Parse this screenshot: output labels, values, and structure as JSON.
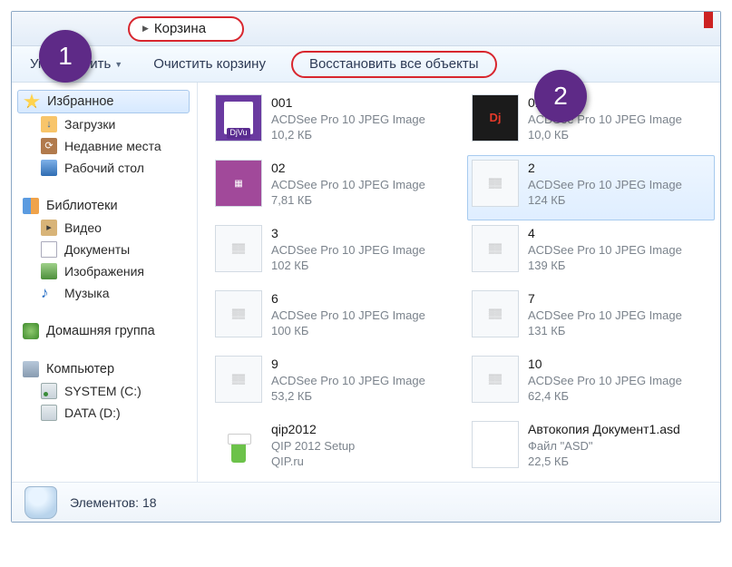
{
  "header": {
    "breadcrumb": "Корзина"
  },
  "callouts": {
    "one": "1",
    "two": "2"
  },
  "toolbar": {
    "organize": "Упорядочить",
    "empty": "Очистить корзину",
    "restore": "Восстановить все объекты"
  },
  "sidebar": {
    "fav_header": "Избранное",
    "fav_items": [
      {
        "label": "Загрузки"
      },
      {
        "label": "Недавние места"
      },
      {
        "label": "Рабочий стол"
      }
    ],
    "lib_header": "Библиотеки",
    "lib_items": [
      {
        "label": "Видео"
      },
      {
        "label": "Документы"
      },
      {
        "label": "Изображения"
      },
      {
        "label": "Музыка"
      }
    ],
    "homegroup": "Домашняя группа",
    "computer": "Компьютер",
    "drives": [
      {
        "label": "SYSTEM (C:)"
      },
      {
        "label": "DATA (D:)"
      }
    ]
  },
  "files": [
    {
      "name": "001",
      "type": "ACDSee Pro 10 JPEG Image",
      "size": "10,2 КБ",
      "thumb": "djvu"
    },
    {
      "name": "01",
      "type": "ACDSee Pro 10 JPEG Image",
      "size": "10,0 КБ",
      "thumb": "dj2"
    },
    {
      "name": "02",
      "type": "ACDSee Pro 10 JPEG Image",
      "size": "7,81 КБ",
      "thumb": "purple"
    },
    {
      "name": "2",
      "type": "ACDSee Pro 10 JPEG Image",
      "size": "124 КБ",
      "thumb": "img",
      "selected": true
    },
    {
      "name": "3",
      "type": "ACDSee Pro 10 JPEG Image",
      "size": "102 КБ",
      "thumb": "img"
    },
    {
      "name": "4",
      "type": "ACDSee Pro 10 JPEG Image",
      "size": "139 КБ",
      "thumb": "img"
    },
    {
      "name": "6",
      "type": "ACDSee Pro 10 JPEG Image",
      "size": "100 КБ",
      "thumb": "img"
    },
    {
      "name": "7",
      "type": "ACDSee Pro 10 JPEG Image",
      "size": "131 КБ",
      "thumb": "img"
    },
    {
      "name": "9",
      "type": "ACDSee Pro 10 JPEG Image",
      "size": "53,2 КБ",
      "thumb": "img"
    },
    {
      "name": "10",
      "type": "ACDSee Pro 10 JPEG Image",
      "size": "62,4 КБ",
      "thumb": "img"
    },
    {
      "name": "qip2012",
      "type": "QIP 2012 Setup",
      "size": "QIP.ru",
      "thumb": "qip"
    },
    {
      "name": "Автокопия Документ1.asd",
      "type": "Файл \"ASD\"",
      "size": "22,5 КБ",
      "thumb": "blank"
    }
  ],
  "status": {
    "count_label": "Элементов: 18"
  }
}
